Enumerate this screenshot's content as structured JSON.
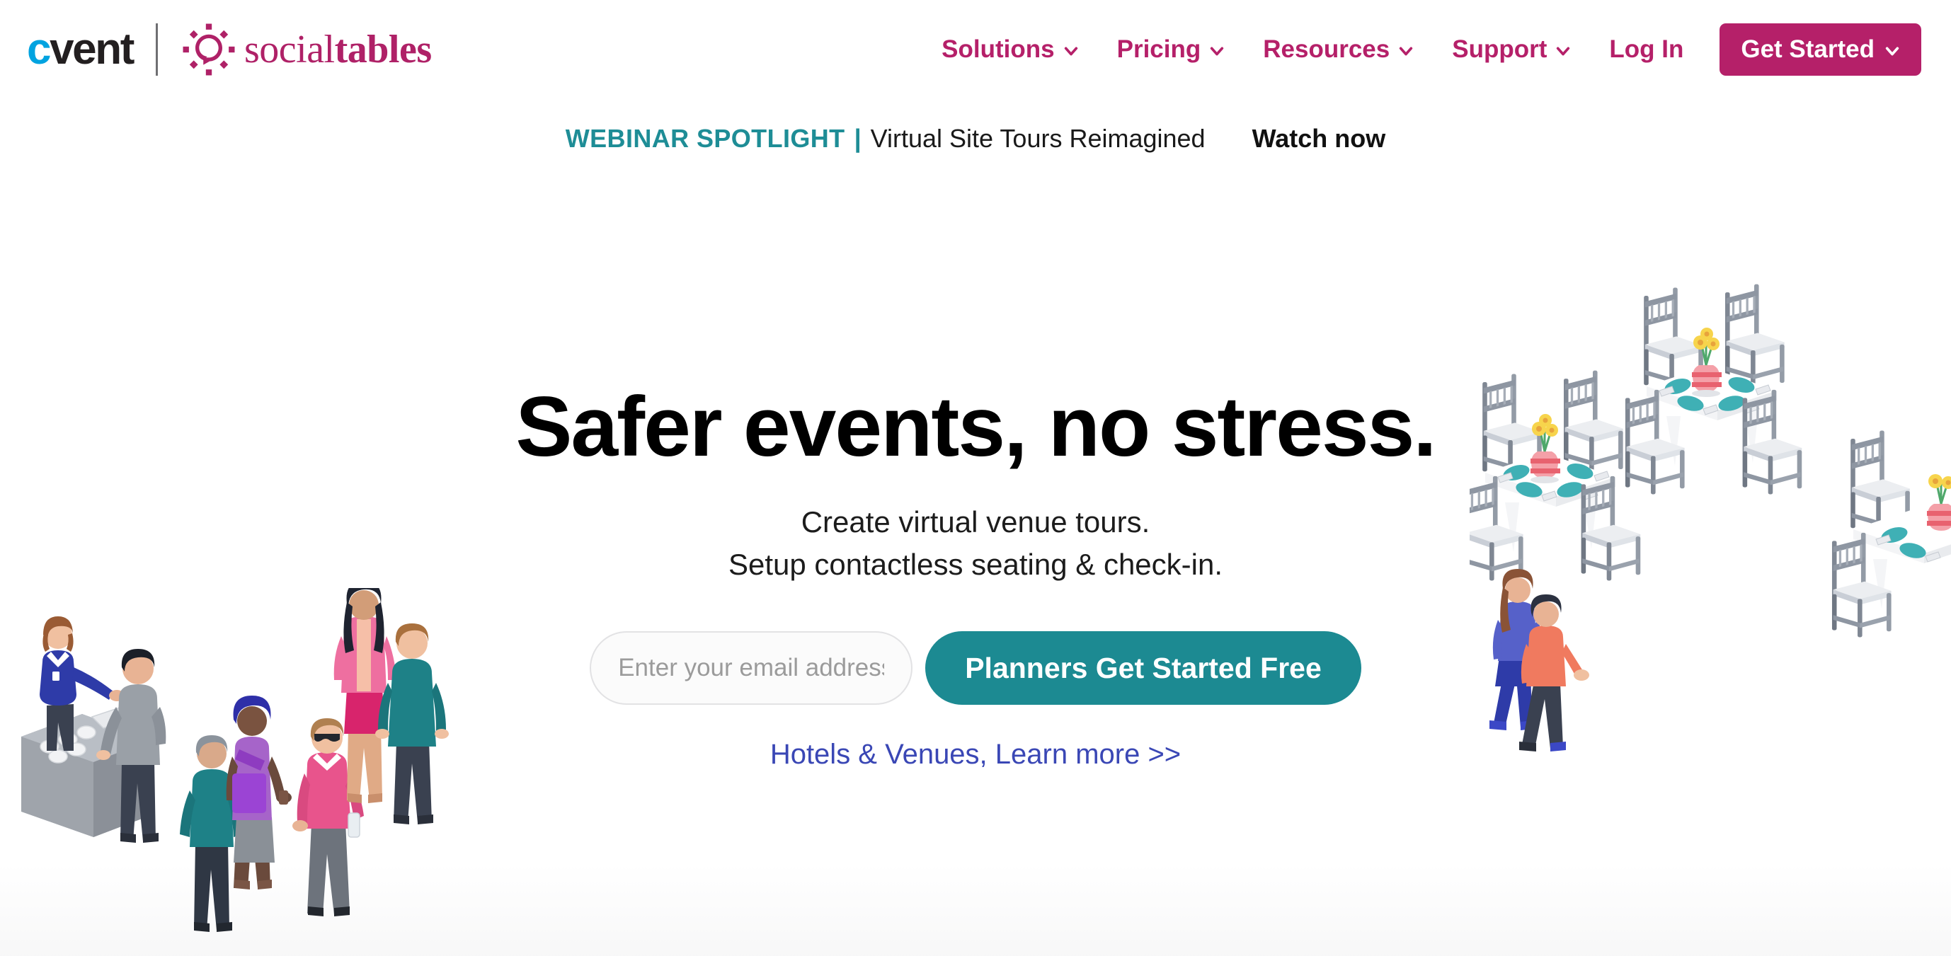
{
  "brand": {
    "cvent_c": "c",
    "cvent_rest": "vent",
    "social_word": "social",
    "tables_word": "tables",
    "mark_name": "socialtables-lightbulb-icon"
  },
  "nav": {
    "items": [
      {
        "label": "Solutions",
        "has_caret": true
      },
      {
        "label": "Pricing",
        "has_caret": true
      },
      {
        "label": "Resources",
        "has_caret": true
      },
      {
        "label": "Support",
        "has_caret": true
      },
      {
        "label": "Log In",
        "has_caret": false
      }
    ],
    "cta": {
      "label": "Get Started",
      "has_caret": true
    }
  },
  "banner": {
    "label": "WEBINAR SPOTLIGHT",
    "pipe": "|",
    "title": "Virtual Site Tours Reimagined",
    "cta": "Watch now"
  },
  "hero": {
    "title": "Safer events, no stress.",
    "sub_line_1": "Create virtual venue tours.",
    "sub_line_2": "Setup contactless seating & check-in.",
    "email_placeholder": "Enter your email address",
    "email_value": "",
    "submit_label": "Planners Get Started Free",
    "secondary_link": "Hotels & Venues, Learn more >>"
  },
  "illustrations": {
    "left_name": "event-checkin-people-illustration",
    "right_name": "isometric-banquet-tables-illustration"
  },
  "colors": {
    "brand_magenta": "#B52069",
    "brand_blue": "#00A3E0",
    "teal": "#1C8A92",
    "banner_teal": "#1E8D96",
    "link_blue": "#3A47B5",
    "text_dark": "#1a1a1a",
    "input_border": "#e2e2e4",
    "placeholder": "#9b9b9b"
  }
}
